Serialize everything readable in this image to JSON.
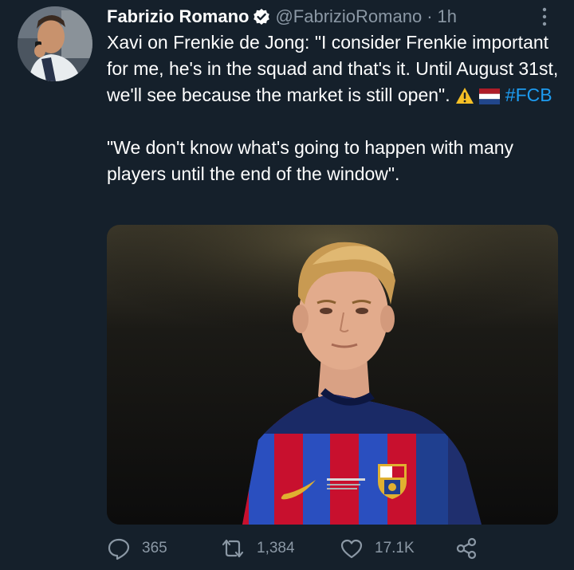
{
  "tweet": {
    "display_name": "Fabrizio Romano",
    "handle": "@FabrizioRomano",
    "separator": "·",
    "time": "1h",
    "text_line1_pre": "Xavi on Frenkie de Jong: \"I consider Frenkie important for me, he's in the squad and that's it. Until August 31st, we'll see because the market is still open\". ",
    "hashtag": "#FCB",
    "text_paragraph2": "\"We don't know what's going to happen with many players until the end of the window\".",
    "emojis": [
      "warning-emoji",
      "netherlands-flag-emoji"
    ]
  },
  "actions": {
    "replies": "365",
    "retweets": "1,384",
    "likes": "17.1K"
  },
  "colors": {
    "background": "#15202b",
    "text": "#ffffff",
    "secondary": "#8b98a5",
    "accent": "#1d9bf0",
    "jersey_blue": "#1f3f8f",
    "jersey_red": "#c8102e"
  },
  "icons": {
    "verified": "verified-badge-icon",
    "more": "more-vertical-icon",
    "reply": "reply-icon",
    "retweet": "retweet-icon",
    "like": "heart-icon",
    "share": "share-icon"
  }
}
